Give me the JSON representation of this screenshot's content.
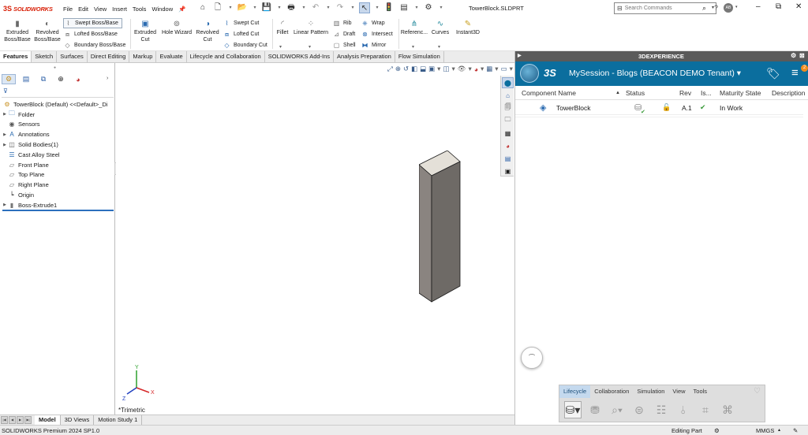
{
  "titlebar": {
    "logo_text": "SOLIDWORKS",
    "menus": [
      "File",
      "Edit",
      "View",
      "Insert",
      "Tools",
      "Window"
    ],
    "document_title": "TowerBlock.SLDPRT",
    "search_placeholder": "Search Commands",
    "avatar_initials": "AB"
  },
  "ribbon": {
    "extruded_boss": "Extruded Boss/Base",
    "revolved_boss": "Revolved Boss/Base",
    "swept_boss": "Swept Boss/Base",
    "lofted_boss": "Lofted Boss/Base",
    "boundary_boss": "Boundary Boss/Base",
    "extruded_cut": "Extruded Cut",
    "hole_wizard": "Hole Wizard",
    "revolved_cut": "Revolved Cut",
    "swept_cut": "Swept Cut",
    "lofted_cut": "Lofted Cut",
    "boundary_cut": "Boundary Cut",
    "fillet": "Fillet",
    "linear_pattern": "Linear Pattern",
    "rib": "Rib",
    "draft": "Draft",
    "shell": "Shell",
    "wrap": "Wrap",
    "intersect": "Intersect",
    "mirror": "Mirror",
    "reference": "Referenc...",
    "curves": "Curves",
    "instant3d": "Instant3D"
  },
  "tabs": [
    "Features",
    "Sketch",
    "Surfaces",
    "Direct Editing",
    "Markup",
    "Evaluate",
    "Lifecycle and Collaboration",
    "SOLIDWORKS Add-Ins",
    "Analysis Preparation",
    "Flow Simulation"
  ],
  "tree": [
    {
      "label": "TowerBlock (Default) <<Default>_Di",
      "icon": "part-icon",
      "expand": false,
      "indent": 0
    },
    {
      "label": "Folder",
      "icon": "folder-icon",
      "expand": true,
      "indent": 1
    },
    {
      "label": "Sensors",
      "icon": "sensors-icon",
      "expand": false,
      "indent": 1
    },
    {
      "label": "Annotations",
      "icon": "annotations-icon",
      "expand": true,
      "indent": 1
    },
    {
      "label": "Solid Bodies(1)",
      "icon": "solid-bodies-icon",
      "expand": true,
      "indent": 1
    },
    {
      "label": "Cast Alloy Steel",
      "icon": "material-icon",
      "expand": false,
      "indent": 1
    },
    {
      "label": "Front Plane",
      "icon": "plane-icon",
      "expand": false,
      "indent": 1
    },
    {
      "label": "Top Plane",
      "icon": "plane-icon",
      "expand": false,
      "indent": 1
    },
    {
      "label": "Right Plane",
      "icon": "plane-icon",
      "expand": false,
      "indent": 1
    },
    {
      "label": "Origin",
      "icon": "origin-icon",
      "expand": false,
      "indent": 1
    },
    {
      "label": "Boss-Extrude1",
      "icon": "extrude-icon",
      "expand": true,
      "indent": 1
    }
  ],
  "graphics": {
    "view_label": "*Trimetric",
    "triad_x": "X",
    "triad_y": "Y",
    "triad_z": "Z"
  },
  "bottom_tabs": [
    "Model",
    "3D Views",
    "Motion Study 1"
  ],
  "statusbar": {
    "version": "SOLIDWORKS Premium 2024 SP1.0",
    "mode": "Editing Part",
    "units": "MMGS"
  },
  "xp": {
    "header": "3DEXPERIENCE",
    "session": "MySession - Blogs (BEACON DEMO Tenant)",
    "notification_count": "2",
    "columns": {
      "component_name": "Component Name",
      "status": "Status",
      "rev": "Rev",
      "is": "Is...",
      "maturity": "Maturity State",
      "description": "Description"
    },
    "row": {
      "name": "TowerBlock",
      "rev": "A.1",
      "maturity": "In Work"
    },
    "action_tabs": [
      "Lifecycle",
      "Collaboration",
      "Simulation",
      "View",
      "Tools"
    ],
    "active_action_tab": "Lifecycle"
  },
  "colors": {
    "brand_red": "#d81e05",
    "xp_blue": "#0b6e9e",
    "selection_blue": "#2c6fbd",
    "check_green": "#3a9a3a"
  }
}
